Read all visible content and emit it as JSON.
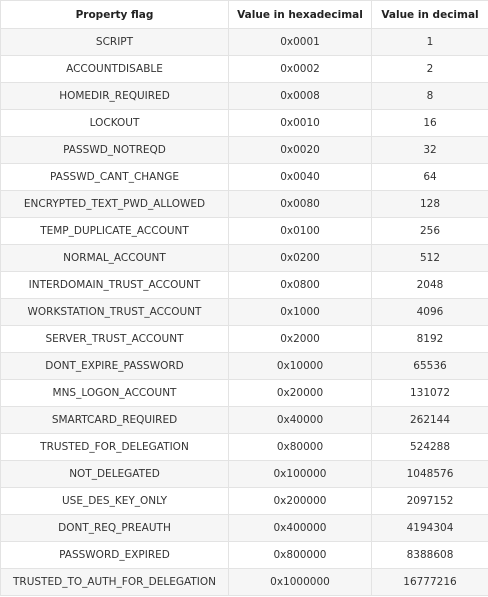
{
  "table": {
    "headers": [
      "Property flag",
      "Value in hexadecimal",
      "Value in decimal"
    ],
    "rows": [
      [
        "SCRIPT",
        "0x0001",
        "1"
      ],
      [
        "ACCOUNTDISABLE",
        "0x0002",
        "2"
      ],
      [
        "HOMEDIR_REQUIRED",
        "0x0008",
        "8"
      ],
      [
        "LOCKOUT",
        "0x0010",
        "16"
      ],
      [
        "PASSWD_NOTREQD",
        "0x0020",
        "32"
      ],
      [
        "PASSWD_CANT_CHANGE",
        "0x0040",
        "64"
      ],
      [
        "ENCRYPTED_TEXT_PWD_ALLOWED",
        "0x0080",
        "128"
      ],
      [
        "TEMP_DUPLICATE_ACCOUNT",
        "0x0100",
        "256"
      ],
      [
        "NORMAL_ACCOUNT",
        "0x0200",
        "512"
      ],
      [
        "INTERDOMAIN_TRUST_ACCOUNT",
        "0x0800",
        "2048"
      ],
      [
        "WORKSTATION_TRUST_ACCOUNT",
        "0x1000",
        "4096"
      ],
      [
        "SERVER_TRUST_ACCOUNT",
        "0x2000",
        "8192"
      ],
      [
        "DONT_EXPIRE_PASSWORD",
        "0x10000",
        "65536"
      ],
      [
        "MNS_LOGON_ACCOUNT",
        "0x20000",
        "131072"
      ],
      [
        "SMARTCARD_REQUIRED",
        "0x40000",
        "262144"
      ],
      [
        "TRUSTED_FOR_DELEGATION",
        "0x80000",
        "524288"
      ],
      [
        "NOT_DELEGATED",
        "0x100000",
        "1048576"
      ],
      [
        "USE_DES_KEY_ONLY",
        "0x200000",
        "2097152"
      ],
      [
        "DONT_REQ_PREAUTH",
        "0x400000",
        "4194304"
      ],
      [
        "PASSWORD_EXPIRED",
        "0x800000",
        "8388608"
      ],
      [
        "TRUSTED_TO_AUTH_FOR_DELEGATION",
        "0x1000000",
        "16777216"
      ]
    ]
  }
}
